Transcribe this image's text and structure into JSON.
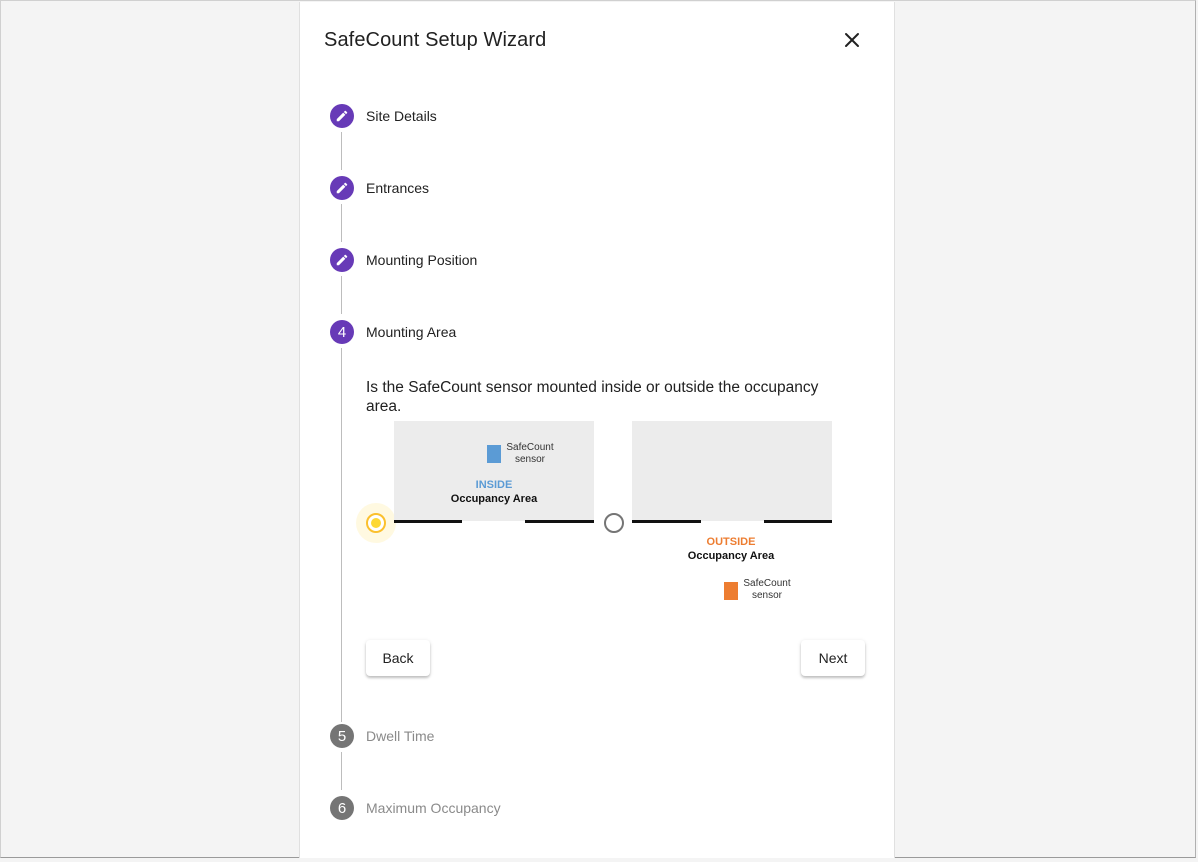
{
  "dialog": {
    "title": "SafeCount Setup Wizard",
    "close_icon": "close-icon"
  },
  "steps": [
    {
      "marker": "",
      "icon": "pencil-icon",
      "label": "Site Details",
      "state": "completed"
    },
    {
      "marker": "",
      "icon": "pencil-icon",
      "label": "Entrances",
      "state": "completed"
    },
    {
      "marker": "",
      "icon": "pencil-icon",
      "label": "Mounting Position",
      "state": "completed"
    },
    {
      "marker": "4",
      "label": "Mounting Area",
      "state": "active"
    },
    {
      "marker": "5",
      "label": "Dwell Time",
      "state": "pending"
    },
    {
      "marker": "6",
      "label": "Maximum Occupancy",
      "state": "pending"
    }
  ],
  "mounting_area": {
    "question": "Is the SafeCount sensor mounted inside or outside the occupancy area.",
    "options": [
      {
        "id": "inside",
        "selected": true,
        "location_word": "INSIDE",
        "area_label": "Occupancy Area",
        "sensor_label_line1": "SafeCount",
        "sensor_label_line2": "sensor",
        "color": "#5b9bd5"
      },
      {
        "id": "outside",
        "selected": false,
        "location_word": "OUTSIDE",
        "area_label": "Occupancy Area",
        "sensor_label_line1": "SafeCount",
        "sensor_label_line2": "sensor",
        "color": "#ed7d31"
      }
    ]
  },
  "actions": {
    "back_label": "Back",
    "next_label": "Next"
  },
  "colors": {
    "step_active": "#673ab7",
    "step_pending": "#757575",
    "radio_selected": "#fdd835"
  }
}
